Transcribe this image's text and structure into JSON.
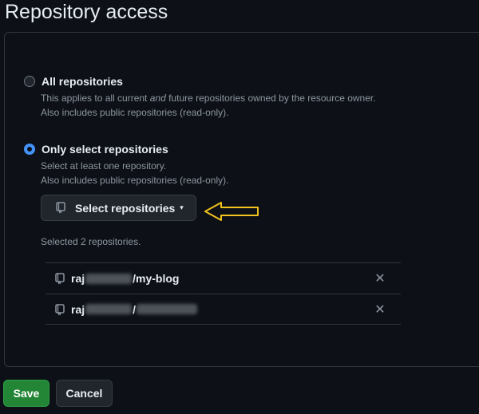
{
  "page": {
    "title": "Repository access"
  },
  "options": {
    "all": {
      "label": "All repositories",
      "note_before": "This applies to all current ",
      "note_em": "and",
      "note_after": " future repositories owned by the resource owner.",
      "note2": "Also includes public repositories (read-only).",
      "checked": false
    },
    "select": {
      "label": "Only select repositories",
      "note1": "Select at least one repository.",
      "note2": "Also includes public repositories (read-only).",
      "checked": true
    }
  },
  "select_button": {
    "label": "Select repositories",
    "icon": "repo-icon",
    "caret": "▾"
  },
  "annotation": {
    "arrow_color": "#f0c21c"
  },
  "selected_summary": "Selected 2 repositories.",
  "repos": [
    {
      "owner_visible": "raj",
      "separator": "/",
      "name_visible": "my-blog",
      "remove": "✕"
    },
    {
      "owner_visible": "raj",
      "separator": "/",
      "name_visible": "",
      "remove": "✕"
    }
  ],
  "actions": {
    "save": "Save",
    "cancel": "Cancel"
  },
  "colors": {
    "background": "#0d1117",
    "accent": "#4493f8",
    "save": "#238636"
  }
}
